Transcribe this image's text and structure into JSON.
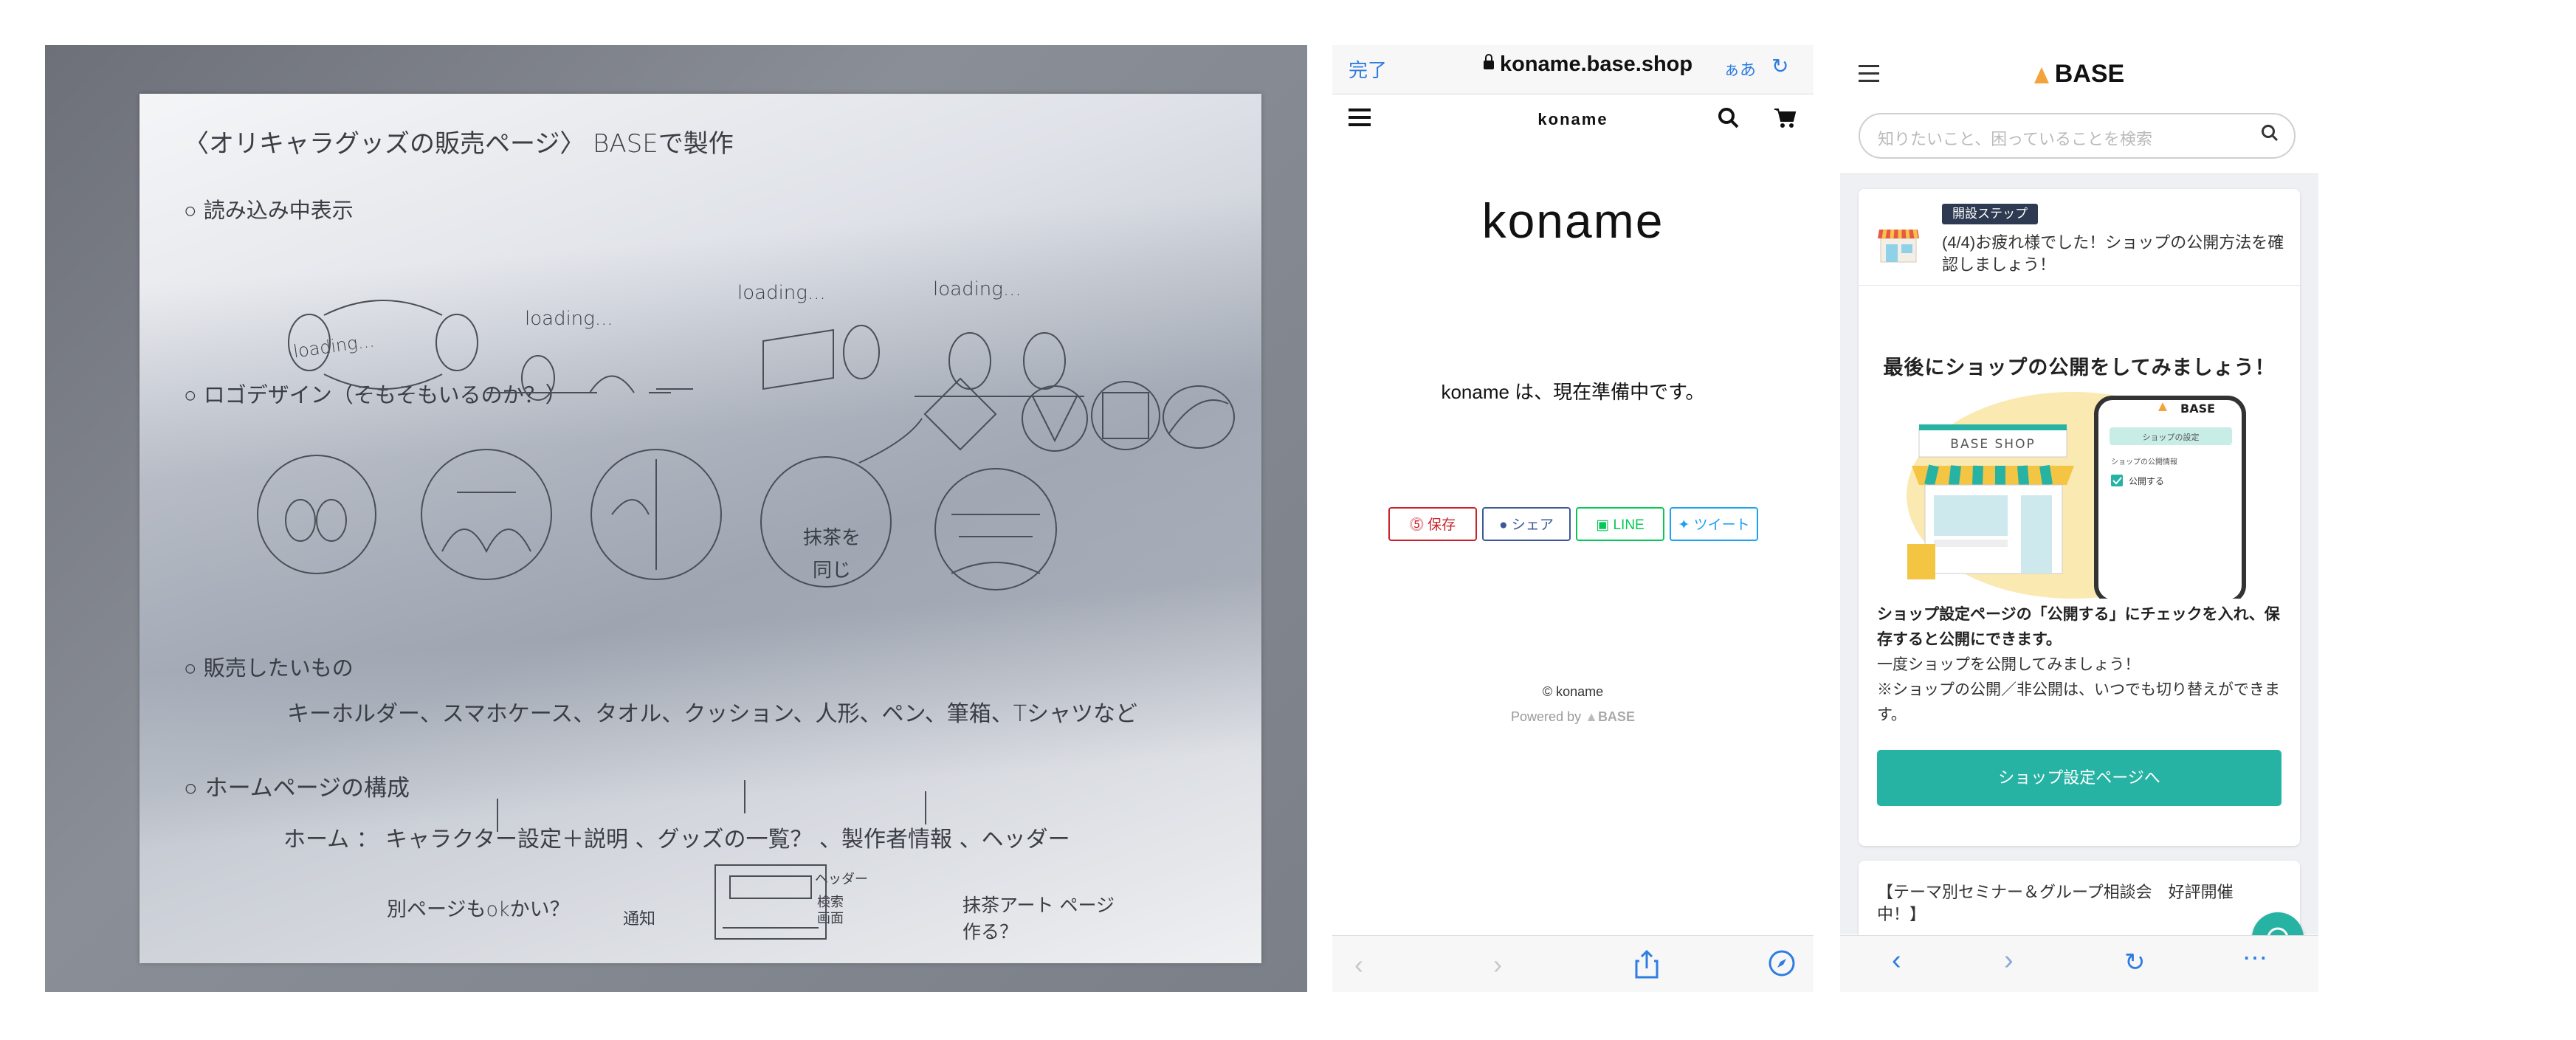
{
  "sketch": {
    "title": "〈オリキャラグッズの販売ページ〉 BASEで製作",
    "sections": [
      {
        "heading": "読み込み中表示",
        "notes": [
          "loading...",
          "loading...",
          "loading...",
          "loading..."
        ]
      },
      {
        "heading": "ロゴデザイン（そもそもいるのか？）",
        "notes": [
          "抹茶を同じ"
        ]
      },
      {
        "heading": "販売したいもの",
        "notes": [
          "キーホルダー、スマホケース、タオル、クッション、人形、ペン、筆箱、Tシャツなど"
        ]
      },
      {
        "heading": "ホームページの構成",
        "notes": [
          "ホーム ： キャラクター設定＋説明 、グッズの一覧？ 、製作者情報 、ヘッダー",
          "別ページもokかい？",
          "ヘッダー",
          "検索画面",
          "通知",
          "抹茶アート ページ作る？"
        ]
      }
    ]
  },
  "safari": {
    "done_label": "完了",
    "url": "koname.base.shop",
    "text_size_label": "ぁあ",
    "shop_name_small": "koname",
    "shop_title": "koname",
    "message": "koname は、現在準備中です。",
    "share_buttons": [
      {
        "label": "保存",
        "color": "#c8232c"
      },
      {
        "label": "シェア",
        "color": "#3b5998"
      },
      {
        "label": "LINE",
        "color": "#06c755"
      },
      {
        "label": "ツイート",
        "color": "#1da1f2"
      }
    ],
    "copyright": "© koname",
    "powered_by": "Powered by",
    "powered_brand": "BASE"
  },
  "base_app": {
    "logo": "BASE",
    "search_placeholder": "知りたいこと、困っていることを検索",
    "badge": "開設ステップ",
    "step_text": "(4/4)お疲れ様でした！ショップの公開方法を確認しましょう！",
    "heading": "最後にショップの公開をしてみましょう！",
    "illustration": {
      "shop_sign": "BASE SHOP",
      "phone_logo": "BASE",
      "phone_tab": "ショップの設定",
      "phone_section": "ショップの公開情報",
      "phone_checkbox": "公開する"
    },
    "desc_bold": "ショップ設定ページの「公開する」にチェックを入れ、保存すると公開にできます。",
    "desc_line2": "一度ショップを公開してみましょう！",
    "desc_line3": "※ショップの公開／非公開は、いつでも切り替えができます。",
    "cta_button": "ショップ設定ページへ",
    "seminar_text": "【テーマ別セミナー＆グループ相談会　好評開催中！】",
    "accent_color": "#27b3a3"
  }
}
